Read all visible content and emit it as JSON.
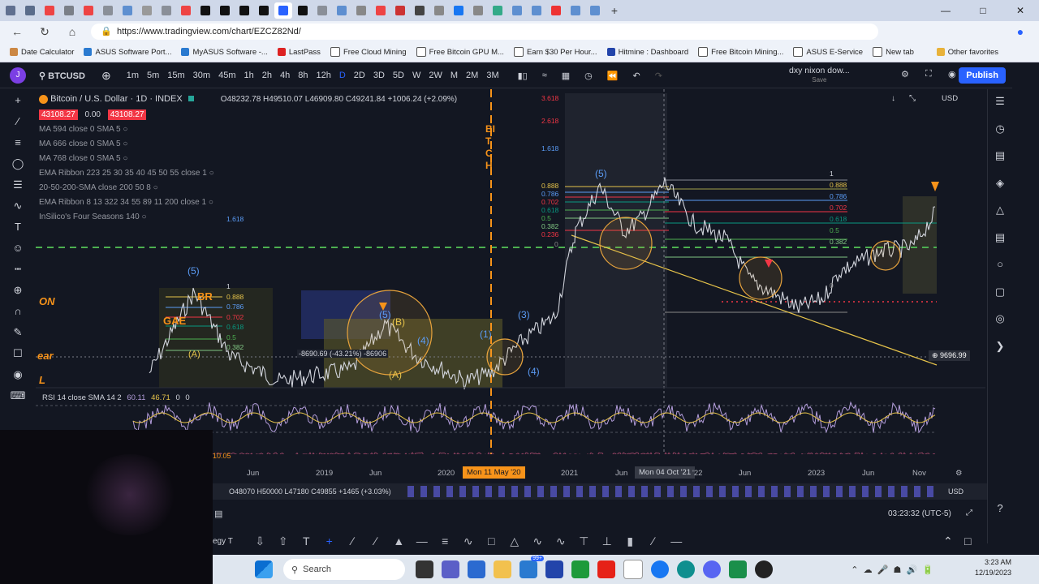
{
  "browser": {
    "url": "https://www.tradingview.com/chart/EZCZ82Nd/",
    "bookmarks": [
      "Date Calculator",
      "ASUS Software Port...",
      "MyASUS Software -...",
      "LastPass",
      "Free Cloud Mining",
      "Free Bitcoin GPU M...",
      "Earn $30 Per Hour...",
      "Hitmine : Dashboard",
      "Free Bitcoin Mining...",
      "ASUS E-Service",
      "New tab"
    ],
    "other_bookmarks": "Other favorites"
  },
  "toolbar": {
    "symbol": "BTCUSD",
    "timeframes": [
      "1m",
      "5m",
      "15m",
      "30m",
      "45m",
      "1h",
      "2h",
      "4h",
      "8h",
      "12h",
      "D",
      "2D",
      "3D",
      "5D",
      "W",
      "2W",
      "M",
      "2M",
      "3M"
    ],
    "selected_tf": "D",
    "layout_name": "dxy nixon dow...",
    "layout_sub": "Save",
    "publish": "Publish"
  },
  "legend": {
    "title": "Bitcoin / U.S. Dollar · 1D · INDEX",
    "ohlc": "O48232.78 H49510.07 L46909.80 C49241.84 +1006.24 (+2.09%)",
    "price_left": "43108.27",
    "price_mid": "0.00",
    "price_right": "43108.27",
    "indicators": [
      "MA 594 close 0 SMA 5",
      "MA 666 close 0 SMA 5",
      "MA 768 close 0 SMA 5",
      "EMA Ribbon 223 25 30 35 40 45 50 55 close 1",
      "20-50-200-SMA close 200 50 8",
      "EMA Ribbon 8 13 322 34 55 89 11 200 close 1",
      "InSilico's Four Seasons 140"
    ]
  },
  "rsi": {
    "label": "RSI 14 close SMA 14 2",
    "v1": "60.11",
    "v2": "46.71",
    "v3": "0",
    "v4": "0"
  },
  "annotations": {
    "measure": "-8690.69 (-43.21%) -86906",
    "price_label": "9696.99",
    "fib_right": [
      "1",
      "0.888",
      "0.786",
      "0.702",
      "0.618",
      "0.5",
      "0.382",
      "0"
    ],
    "fib_left": [
      "1",
      "0.888",
      "0.786",
      "0.702",
      "0.618",
      "0.5",
      "0.382"
    ],
    "fib_top": [
      "3.618",
      "2.618",
      "1.618",
      "1.618"
    ],
    "fib_mid": [
      "0.888",
      "0.786",
      "0.702",
      "0.618",
      "0.5",
      "0.382",
      "0.236",
      "0"
    ],
    "waves": [
      "(5)",
      "(5)",
      "(3)",
      "(4)",
      "(1)",
      "(4)",
      "(B)",
      "(A)",
      "(A)",
      "(5)",
      "BR",
      "GAE"
    ],
    "vertical_text": "BITCH",
    "left_text": [
      "ON",
      "ear",
      "L"
    ]
  },
  "time_axis": [
    "Jun",
    "2019",
    "Jun",
    "2020",
    "Mon 11 May '20",
    "2021",
    "Jun",
    "Mon 04 Oct '21",
    "'22",
    "Jun",
    "2023",
    "Jun",
    "Nov"
  ],
  "price_axis_currency": "USD",
  "bottom_strip": {
    "ohlc": "O48070 H50000 L47180 C49855 +1465 (+3.03%)",
    "currency": "USD",
    "start": "10.05"
  },
  "status": {
    "time": "03:23:32 (UTC-5)",
    "left": "egy T"
  },
  "taskbar": {
    "search": "Search",
    "clock_time": "3:23 AM",
    "clock_date": "12/19/2023",
    "badge": "99+"
  }
}
